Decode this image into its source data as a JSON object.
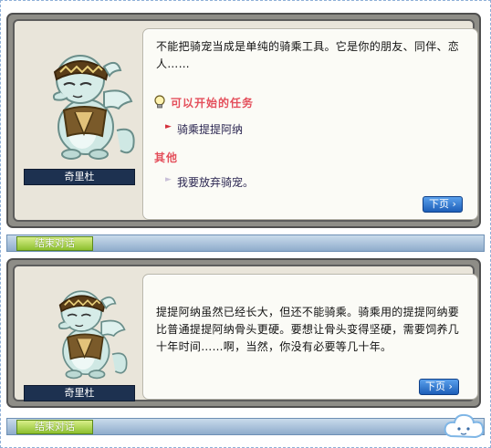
{
  "dialog1": {
    "npc_name": "奇里杜",
    "text": "不能把骑宠当成是单纯的骑乘工具。它是你的朋友、同伴、恋人……",
    "section_available": "可以开始的任务",
    "available_options": [
      "骑乘提提阿纳"
    ],
    "section_other": "其他",
    "other_options": [
      "我要放弃骑宠。"
    ],
    "next_label": "下页",
    "end_label": "结束对话"
  },
  "dialog2": {
    "npc_name": "奇里杜",
    "text": "提提阿纳虽然已经长大，但还不能骑乘。骑乘用的提提阿纳要比普通提提阿纳骨头更硬。要想让骨头变得坚硬，需要饲养几十年时间……啊，当然，你没有必要等几十年。",
    "next_label": "下页",
    "end_label": "结束对话"
  },
  "colors": {
    "panel_frame": "#8e8d87",
    "name_plate": "#1d3150",
    "section_title": "#e44f5b",
    "next_button": "#1d5fb8",
    "end_button": "#8cbf2e",
    "bottom_bar": "#8faccb"
  },
  "icons": {
    "quest_bulb": "lightbulb-icon",
    "option_arrow": "arrow-right-icon",
    "npc": "npc-character-illustration",
    "cloud": "cloud-mascot-icon"
  }
}
